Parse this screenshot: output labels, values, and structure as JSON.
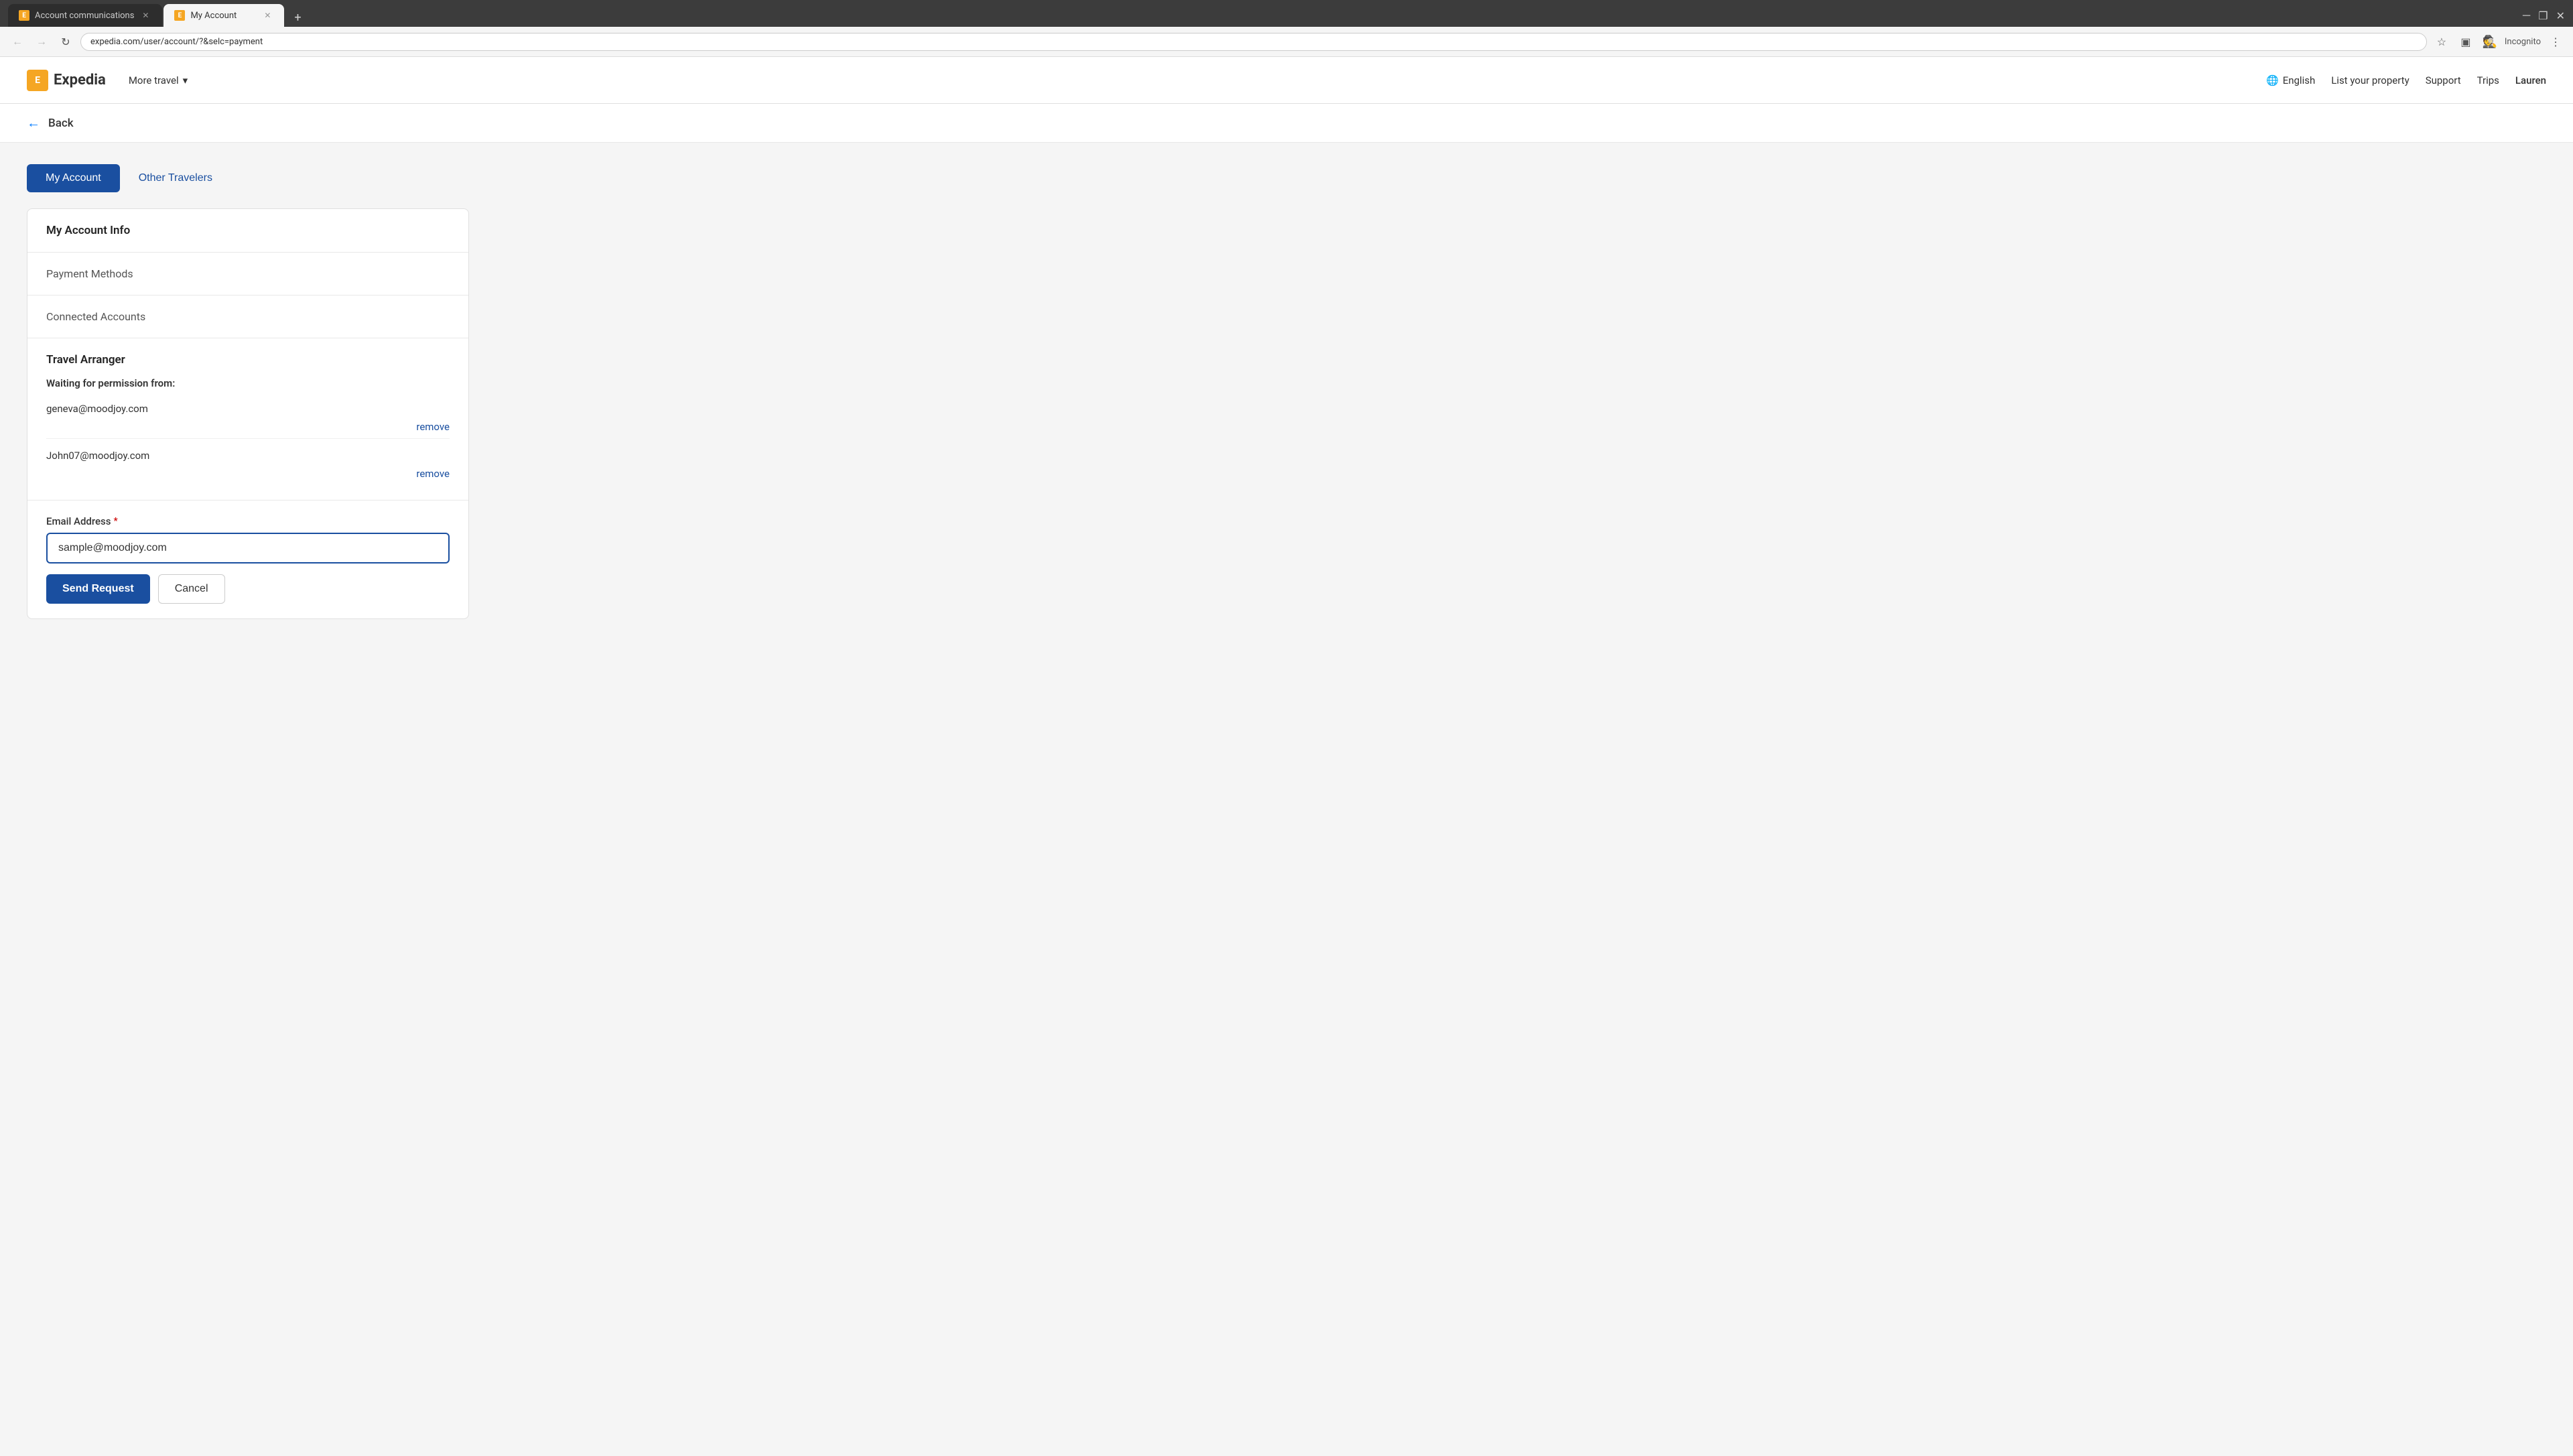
{
  "browser": {
    "tabs": [
      {
        "id": "tab1",
        "favicon": "E",
        "label": "Account communications",
        "active": false,
        "closeable": true
      },
      {
        "id": "tab2",
        "favicon": "E",
        "label": "My Account",
        "active": true,
        "closeable": true
      }
    ],
    "new_tab_icon": "+",
    "window_controls": [
      "–",
      "☐",
      "✕"
    ],
    "address_bar": {
      "url": "expedia.com/user/account/?&selc=payment",
      "back_disabled": false,
      "forward_disabled": true
    }
  },
  "nav": {
    "logo_text": "Expedia",
    "more_travel_label": "More travel",
    "links": [
      {
        "id": "english",
        "label": "English",
        "icon": "🌐"
      },
      {
        "id": "list-property",
        "label": "List your property"
      },
      {
        "id": "support",
        "label": "Support"
      },
      {
        "id": "trips",
        "label": "Trips"
      },
      {
        "id": "user",
        "label": "Lauren"
      }
    ]
  },
  "back": {
    "label": "Back"
  },
  "page": {
    "tabs": [
      {
        "id": "my-account",
        "label": "My Account",
        "active": true
      },
      {
        "id": "other-travelers",
        "label": "Other Travelers",
        "active": false
      }
    ],
    "card": {
      "sections": [
        {
          "id": "account-info",
          "label": "My Account Info",
          "type": "title"
        },
        {
          "id": "payment-methods",
          "label": "Payment Methods",
          "type": "link"
        },
        {
          "id": "connected-accounts",
          "label": "Connected Accounts",
          "type": "link"
        }
      ],
      "travel_arranger": {
        "title": "Travel Arranger",
        "waiting_label": "Waiting for permission from:",
        "emails": [
          {
            "address": "geneva@moodjoy.com",
            "remove_label": "remove"
          },
          {
            "address": "John07@moodjoy.com",
            "remove_label": "remove"
          }
        ]
      },
      "form": {
        "field_label": "Email Address",
        "required": true,
        "placeholder": "sample@moodjoy.com",
        "input_value": "sample@moodjoy.com",
        "send_button": "Send Request",
        "cancel_button": "Cancel"
      }
    }
  }
}
